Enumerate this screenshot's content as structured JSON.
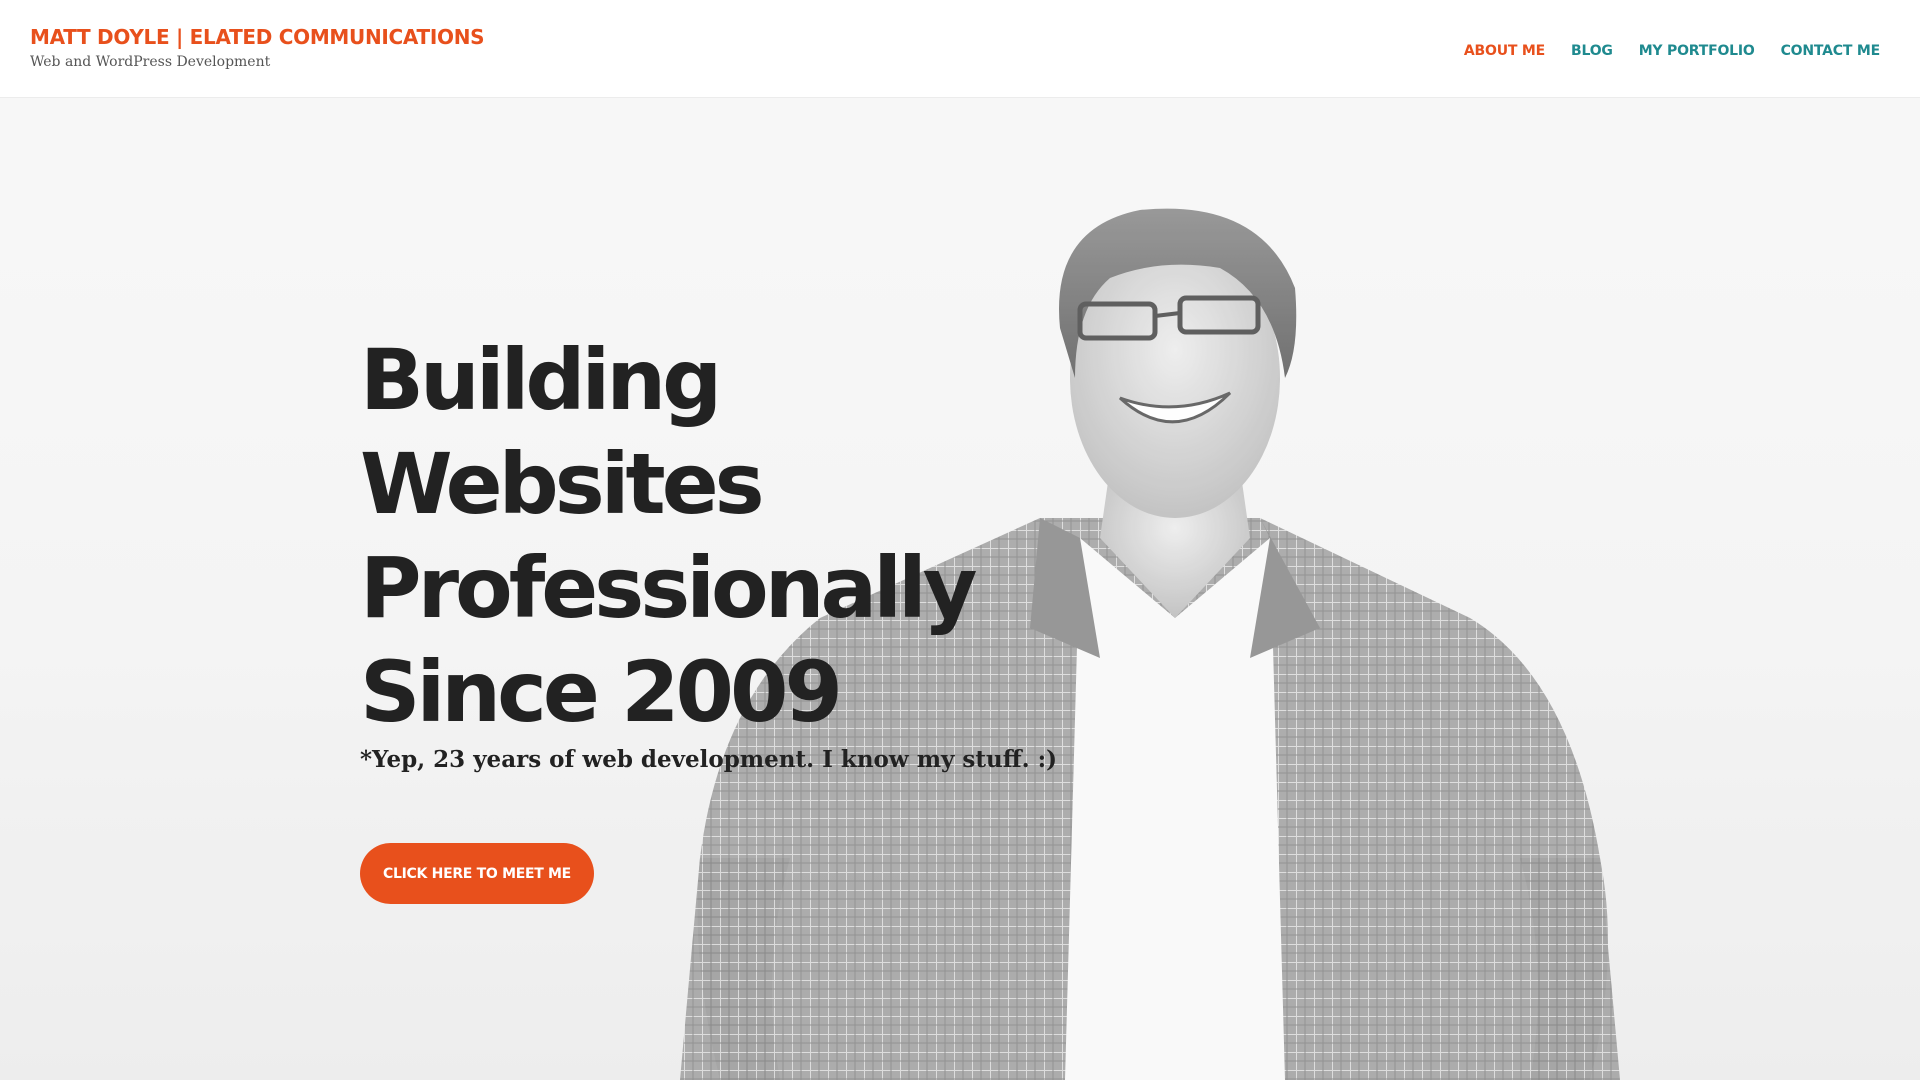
{
  "header": {
    "site_title": "MATT DOYLE | ELATED COMMUNICATIONS",
    "tagline": "Web and WordPress Development"
  },
  "nav": {
    "items": [
      {
        "label": "ABOUT ME",
        "active": true
      },
      {
        "label": "BLOG",
        "active": false
      },
      {
        "label": "MY PORTFOLIO",
        "active": false
      },
      {
        "label": "CONTACT ME",
        "active": false
      }
    ]
  },
  "hero": {
    "headline_lines": [
      "Building",
      "Websites",
      "Professionally",
      "Since 2009"
    ],
    "subline": "*Yep, 23 years of web development. I know my stuff. :)",
    "cta_label": "CLICK HERE TO MEET ME"
  },
  "colors": {
    "accent": "#e8501c",
    "nav_link": "#1f8a8f",
    "nav_active": "#e8501c",
    "headline": "#222222"
  }
}
